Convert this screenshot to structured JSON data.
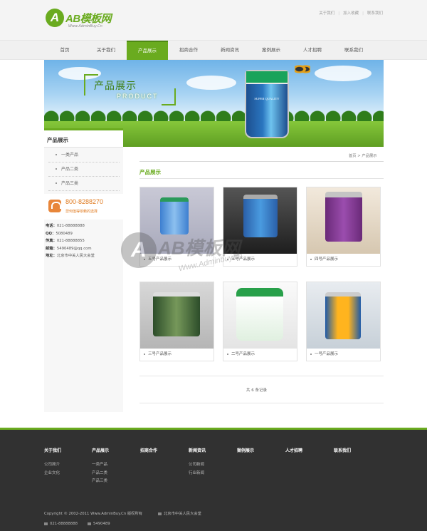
{
  "brand": {
    "mark": "A",
    "name": "AB模板网",
    "url": "Www.AdminBuy.Cn"
  },
  "toplinks": [
    "关于我们",
    "加入收藏",
    "联系我们"
  ],
  "nav": [
    "首页",
    "关于我们",
    "产品展示",
    "招商合作",
    "新闻资讯",
    "案例展示",
    "人才招聘",
    "联系我们"
  ],
  "nav_active": 2,
  "banner": {
    "title": "产品展示",
    "subtitle": "PRODUCT",
    "bucket_text": "SUPER QUALITY"
  },
  "sidebar": {
    "title": "产品展示",
    "items": [
      "一类产品",
      "产品二类",
      "产品三类"
    ],
    "hotline": "800-8288270",
    "hotline_caption": "您何值得依赖的选择",
    "contact": [
      {
        "label": "电话：",
        "value": "021-88888888"
      },
      {
        "label": "QQ：",
        "value": "5080489"
      },
      {
        "label": "传真：",
        "value": "021-88888855"
      },
      {
        "label": "邮箱：",
        "value": "5490489@qq.com"
      },
      {
        "label": "地址：",
        "value": "北京市中关人民大会堂"
      }
    ]
  },
  "main": {
    "breadcrumb": "首页 > 产品展示",
    "title": "产品展示",
    "products": [
      {
        "name": "五号产品展示"
      },
      {
        "name": "五号产品展示"
      },
      {
        "name": "四号产品展示"
      },
      {
        "name": "三号产品展示"
      },
      {
        "name": "二号产品展示"
      },
      {
        "name": "一号产品展示"
      }
    ],
    "pager": "共 6 条记录"
  },
  "watermark": {
    "mark": "A",
    "text": "AB模板网",
    "sub": "Www.Adminbuy.cn"
  },
  "footer": {
    "columns": [
      {
        "title": "关于我们",
        "items": [
          "公司简介",
          "企业文化"
        ]
      },
      {
        "title": "产品展示",
        "items": [
          "一类产品",
          "产品二类",
          "产品三类"
        ]
      },
      {
        "title": "招商合作",
        "items": []
      },
      {
        "title": "新闻资讯",
        "items": [
          "公司新闻",
          "行业新闻"
        ]
      },
      {
        "title": "案例展示",
        "items": []
      },
      {
        "title": "人才招聘",
        "items": []
      },
      {
        "title": "联系我们",
        "items": []
      }
    ],
    "copyright": "Copyright © 2002-2011 Www.AdminBuy.Cn 版权所有",
    "address": "北京市中关人民大会堂",
    "tel": "021-88888888",
    "fax": "5490489"
  },
  "colors": {
    "accent": "#6aab1f",
    "footer_bg": "#313131"
  }
}
